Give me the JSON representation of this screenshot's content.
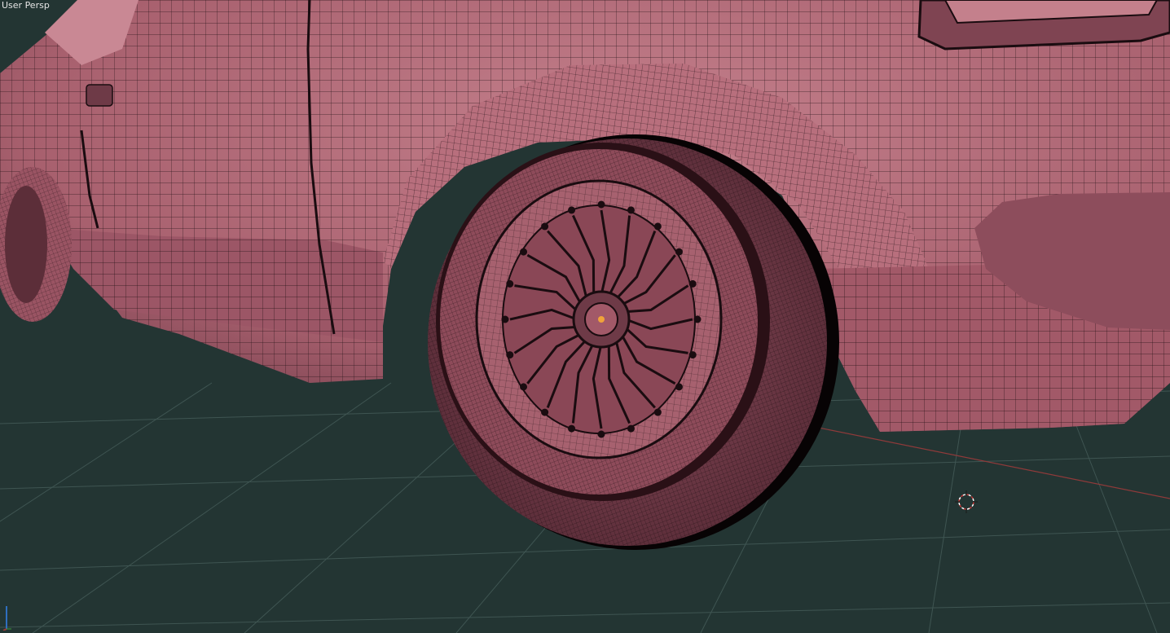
{
  "viewport": {
    "view_label": "User Persp"
  },
  "colors": {
    "background": "#233533",
    "grid_line": "#3a4f4c",
    "mesh_body": "#a8606e",
    "mesh_shadow": "#6e3a47",
    "wire": "#1a0c10",
    "axis_x": "#9a3a3a",
    "axis_z": "#2f6fbf",
    "cursor_red": "#c83a3a"
  },
  "icons": {
    "cursor": "3d-cursor-icon",
    "gizmo": "axis-gizmo-icon"
  }
}
